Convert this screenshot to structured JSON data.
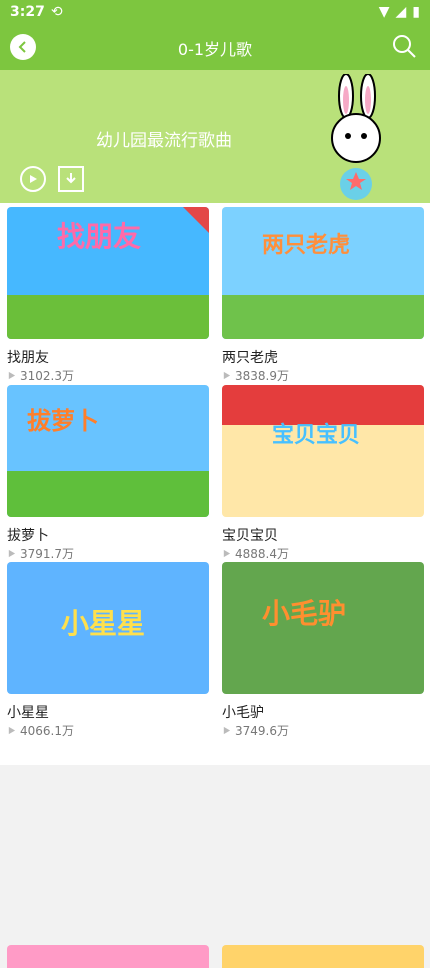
{
  "status": {
    "time": "3:27"
  },
  "header": {
    "title": "0-1岁儿歌"
  },
  "banner": {
    "slogan": "幼儿园最流行歌曲"
  },
  "items": [
    {
      "title": "找朋友",
      "plays": "3102.3万",
      "thumb_title": "找朋友",
      "bg": "#46b8ff",
      "badge": true
    },
    {
      "title": "两只老虎",
      "plays": "3838.9万",
      "thumb_title": "两只老虎",
      "bg": "#7cd1ff",
      "badge": false
    },
    {
      "title": "拔萝卜",
      "plays": "3791.7万",
      "thumb_title": "拔萝卜",
      "bg": "#68c3ff",
      "badge": false
    },
    {
      "title": "宝贝宝贝",
      "plays": "4888.4万",
      "thumb_title": "宝贝宝贝",
      "bg": "#ffe7a8",
      "badge": false
    },
    {
      "title": "小星星",
      "plays": "4066.1万",
      "thumb_title": "小星星",
      "bg": "#5fb4ff",
      "badge": false
    },
    {
      "title": "小毛驴",
      "plays": "3749.6万",
      "thumb_title": "小毛驴",
      "bg": "#63a64e",
      "badge": false
    }
  ],
  "bottom": [
    {
      "thumb_title": "",
      "bg": "#ff9bc6"
    },
    {
      "thumb_title": "",
      "bg": "#ffd36a"
    }
  ],
  "colors": {
    "accent": "#7dc63f",
    "banner": "#b9e17a"
  }
}
